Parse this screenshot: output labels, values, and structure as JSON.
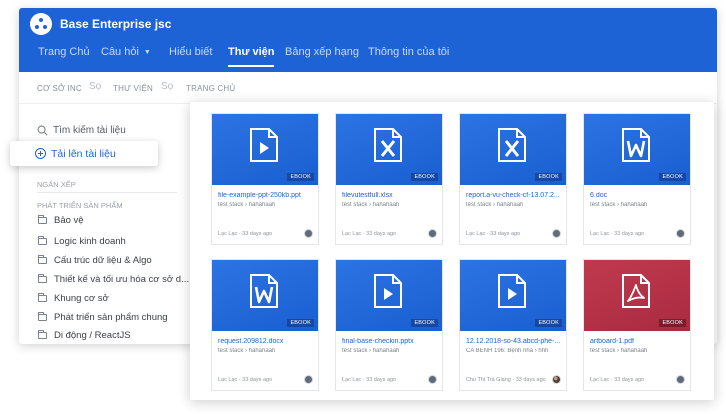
{
  "app": {
    "brand": "Base Enterprise jsc",
    "nav": [
      {
        "label": "Trang Chủ"
      },
      {
        "label": "Câu hỏi",
        "has_caret": true
      },
      {
        "label": "Hiểu biết"
      },
      {
        "label": "Thư viện",
        "active": true
      },
      {
        "label": "Bảng xếp hạng"
      },
      {
        "label": "Thông tin của tôi"
      }
    ],
    "breadcrumb": {
      "items": [
        "CƠ SỞ INC",
        "THƯ VIỆN",
        "TRANG CHỦ"
      ],
      "separator": "Sọ"
    }
  },
  "sidebar": {
    "search_label": "Tìm kiếm tài liệu",
    "upload_label": "Tải lên tài liệu",
    "section_title": "NGĂN XẾP",
    "group_title": "PHÁT TRIỂN SẢN PHẨM",
    "folders": [
      "Bảo vệ",
      "Logic kinh doanh",
      "Cấu trúc dữ liệu & Algo",
      "Thiết kế và tối ưu hóa cơ sở d...",
      "Khung cơ sở",
      "Phát triển sản phẩm chung",
      "Di động / ReactJS"
    ]
  },
  "files": [
    {
      "name": "file-example-ppt-250kb.ppt",
      "meta": "test stack › hahahaah",
      "footer": "Lạc Lạc · 33 days ago",
      "badge": "EBOOK",
      "icon": "ppt-file-icon",
      "color": "#1e63d6"
    },
    {
      "name": "filevutestfull.xlsx",
      "meta": "test stack › hahahaah",
      "footer": "Lạc Lạc · 33 days ago",
      "badge": "EBOOK",
      "icon": "excel-file-icon",
      "color": "#1e63d6"
    },
    {
      "name": "report.a-vu-check-cf-13.07.2...",
      "meta": "test stack › hahahaah",
      "footer": "Lạc Lạc · 33 days ago",
      "badge": "EBOOK",
      "icon": "excel-file-icon",
      "color": "#1e63d6"
    },
    {
      "name": "6.doc",
      "meta": "test stack › hahahaah",
      "footer": "Lạc Lạc · 33 days ago",
      "badge": "EBOOK",
      "icon": "word-file-icon",
      "color": "#1e63d6"
    },
    {
      "name": "request.209812.docx",
      "meta": "test stack › hahahaah",
      "footer": "Lạc Lạc · 33 days ago",
      "badge": "EBOOK",
      "icon": "word-file-icon",
      "color": "#1e63d6"
    },
    {
      "name": "final-base-checkin.pptx",
      "meta": "test stack › hahahaah",
      "footer": "Lạc Lạc · 33 days ago",
      "badge": "EBOOK",
      "icon": "ppt-file-icon",
      "color": "#1e63d6"
    },
    {
      "name": "12.12.2018-so-43.abcd-phe-...",
      "meta": "CA BENH 196: Bệnh nhà › hhh",
      "footer": "Chu Thị Trà Giang · 33 days ago",
      "badge": "EBOOK",
      "icon": "ppt-file-icon",
      "color": "#1e63d6"
    },
    {
      "name": "artboard-1.pdf",
      "meta": "test stack › hahahaah",
      "footer": "Lạc Lạc · 33 days ago",
      "badge": "EBOOK",
      "icon": "pdf-file-icon",
      "color": "#b3344a"
    }
  ]
}
